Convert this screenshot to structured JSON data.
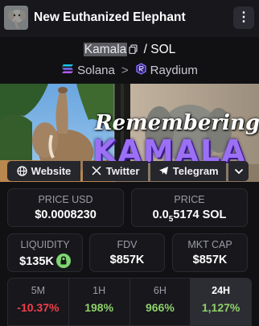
{
  "header": {
    "title": "New Euthanized Elephant"
  },
  "pair": {
    "base": "Kamala",
    "separator": "/",
    "quote": "SOL"
  },
  "chain": {
    "network": "Solana",
    "separator": ">",
    "dex": "Raydium"
  },
  "banner": {
    "line1": "Remembering",
    "line2": "KAMALA"
  },
  "socials": {
    "website": "Website",
    "twitter": "Twitter",
    "telegram": "Telegram"
  },
  "stats": {
    "price_usd_label": "PRICE USD",
    "price_usd": "$0.0008230",
    "price_label": "PRICE",
    "price_prefix": "0.0",
    "price_zeros": "5",
    "price_digits": "5174 SOL",
    "liquidity_label": "LIQUIDITY",
    "liquidity": "$135K",
    "fdv_label": "FDV",
    "fdv": "$857K",
    "mcap_label": "MKT CAP",
    "mcap": "$857K"
  },
  "timeframes": [
    {
      "label": "5M",
      "value": "-10.37%",
      "color": "#f23f4a"
    },
    {
      "label": "1H",
      "value": "198%",
      "color": "#8fd16a"
    },
    {
      "label": "6H",
      "value": "966%",
      "color": "#8fd16a"
    },
    {
      "label": "24H",
      "value": "1,127%",
      "color": "#8fd16a"
    }
  ],
  "colors": {
    "positive": "#8fd16a",
    "negative": "#f23f4a",
    "liquidity_lock": "#7ed56f"
  }
}
